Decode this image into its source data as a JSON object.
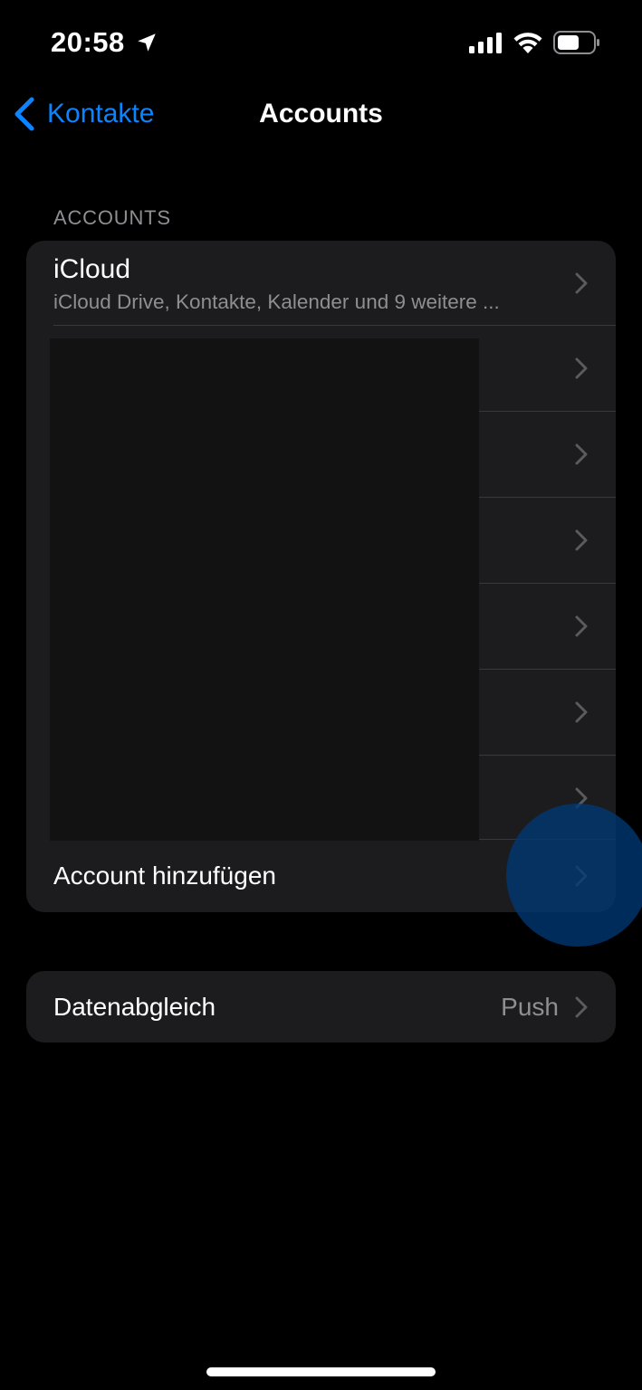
{
  "status_bar": {
    "time": "20:58",
    "icons": [
      "location-arrow-icon",
      "cellular-signal-icon",
      "wifi-icon",
      "battery-icon"
    ]
  },
  "nav": {
    "back_label": "Kontakte",
    "title": "Accounts"
  },
  "accounts_section": {
    "header": "ACCOUNTS",
    "icloud": {
      "title": "iCloud",
      "subtitle": "iCloud Drive, Kontakte, Kalender und 9 weitere ..."
    },
    "hidden_rows_count_note": "",
    "add_account_label": "Account hinzufügen"
  },
  "sync": {
    "label": "Datenabgleich",
    "value": "Push"
  },
  "colors": {
    "background": "#000000",
    "group_background": "#1c1c1e",
    "accent": "#0a84ff",
    "secondary_text": "#8e8e93",
    "separator": "#38383a",
    "touch_indicator": "#003875"
  }
}
